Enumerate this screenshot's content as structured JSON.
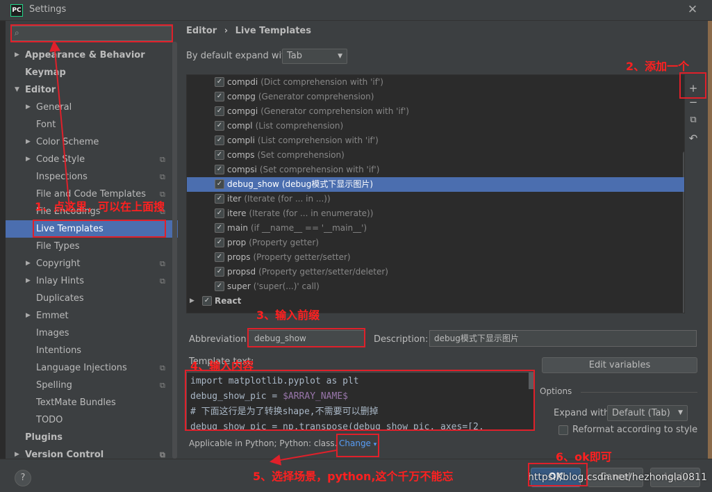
{
  "window": {
    "title": "Settings",
    "logo": "PC",
    "close": "✕"
  },
  "search": {
    "placeholder": "",
    "icon": "search-icon"
  },
  "tree": [
    {
      "label": "Appearance & Behavior",
      "indent": 0,
      "bold": true,
      "arrow": "right"
    },
    {
      "label": "Keymap",
      "indent": 0,
      "bold": true
    },
    {
      "label": "Editor",
      "indent": 0,
      "bold": true,
      "arrow": "down"
    },
    {
      "label": "General",
      "indent": 1,
      "arrow": "right"
    },
    {
      "label": "Font",
      "indent": 2
    },
    {
      "label": "Color Scheme",
      "indent": 1,
      "arrow": "right"
    },
    {
      "label": "Code Style",
      "indent": 1,
      "arrow": "right",
      "copy": true
    },
    {
      "label": "Inspections",
      "indent": 2,
      "copy": true
    },
    {
      "label": "File and Code Templates",
      "indent": 2,
      "copy": true
    },
    {
      "label": "File Encodings",
      "indent": 2,
      "copy": true
    },
    {
      "label": "Live Templates",
      "indent": 2,
      "selected": true
    },
    {
      "label": "File Types",
      "indent": 2
    },
    {
      "label": "Copyright",
      "indent": 1,
      "arrow": "right",
      "copy": true
    },
    {
      "label": "Inlay Hints",
      "indent": 1,
      "arrow": "right",
      "copy": true
    },
    {
      "label": "Duplicates",
      "indent": 2
    },
    {
      "label": "Emmet",
      "indent": 1,
      "arrow": "right"
    },
    {
      "label": "Images",
      "indent": 2
    },
    {
      "label": "Intentions",
      "indent": 2
    },
    {
      "label": "Language Injections",
      "indent": 2,
      "copy": true
    },
    {
      "label": "Spelling",
      "indent": 2,
      "copy": true
    },
    {
      "label": "TextMate Bundles",
      "indent": 2
    },
    {
      "label": "TODO",
      "indent": 2
    },
    {
      "label": "Plugins",
      "indent": 0,
      "bold": true
    },
    {
      "label": "Version Control",
      "indent": 0,
      "bold": true,
      "arrow": "right",
      "copy": true
    }
  ],
  "breadcrumb": {
    "parent": "Editor",
    "sep": "›",
    "current": "Live Templates"
  },
  "expand_default": {
    "label": "By default expand with",
    "value": "Tab"
  },
  "templates": [
    {
      "name": "compdi",
      "desc": "(Dict comprehension with 'if')"
    },
    {
      "name": "compg",
      "desc": "(Generator comprehension)"
    },
    {
      "name": "compgi",
      "desc": "(Generator comprehension with 'if')"
    },
    {
      "name": "compl",
      "desc": "(List comprehension)"
    },
    {
      "name": "compli",
      "desc": "(List comprehension with 'if')"
    },
    {
      "name": "comps",
      "desc": "(Set comprehension)"
    },
    {
      "name": "compsi",
      "desc": "(Set comprehension with 'if')"
    },
    {
      "name": "debug_show",
      "desc": "(debug模式下显示图片)",
      "selected": true
    },
    {
      "name": "iter",
      "desc": "(Iterate (for ... in ...))"
    },
    {
      "name": "itere",
      "desc": "(Iterate (for ... in enumerate))"
    },
    {
      "name": "main",
      "desc": "(if __name__ == '__main__')"
    },
    {
      "name": "prop",
      "desc": "(Property getter)"
    },
    {
      "name": "props",
      "desc": "(Property getter/setter)"
    },
    {
      "name": "propsd",
      "desc": "(Property getter/setter/deleter)"
    },
    {
      "name": "super",
      "desc": "('super(...)' call)"
    }
  ],
  "template_group": "React",
  "toolbar": {
    "add": "+",
    "remove": "−",
    "copy": "⧉",
    "restore": "↶"
  },
  "abbreviation": {
    "label": "Abbreviation:",
    "value": "debug_show"
  },
  "description": {
    "label": "Description:",
    "value": "debug模式下显示图片"
  },
  "template_text": {
    "label": "Template text:",
    "lines": [
      {
        "text": "import matplotlib.pyplot as plt"
      },
      {
        "text": "debug_show_pic = ",
        "var": "$ARRAY_NAME$"
      },
      {
        "text": "# 下面这行是为了转换shape,不需要可以删掉"
      },
      {
        "text": "debug_show_pic = np.transpose(debug_show_pic, axes=[2,"
      }
    ]
  },
  "edit_variables": "Edit variables",
  "options": {
    "label": "Options",
    "expand_with_label": "Expand with",
    "expand_with_value": "Default (Tab)",
    "reformat_label": "Reformat according to style"
  },
  "applicable": {
    "text": "Applicable in Python; Python: class.",
    "change": "Change"
  },
  "footer": {
    "help": "?",
    "ok": "OK",
    "cancel": "Cancel",
    "apply": "Apply",
    "watermark": "https://blog.csdn.net/hezhongla0811"
  },
  "annotations": {
    "a1": "1、点这里，可以在上面搜",
    "a2": "2、添加一个",
    "a3": "3、输入前缀",
    "a4": "4、输入内容",
    "a5": "5、选择场景，python,这个千万不能忘",
    "a6": "6、ok即可"
  },
  "colors": {
    "annotation": "#e0202a",
    "selection": "#4b6eaf",
    "link": "#589df6"
  }
}
